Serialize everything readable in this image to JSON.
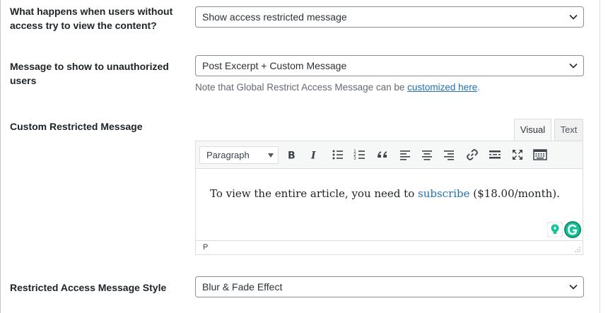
{
  "fields": {
    "access_behavior": {
      "label": "What happens when users without access try to view the content?",
      "value": "Show access restricted message"
    },
    "unauthorized_message": {
      "label": "Message to show to unauthorized users",
      "value": "Post Excerpt + Custom Message",
      "note_prefix": "Note that Global Restrict Access Message can be ",
      "note_link": "customized here",
      "note_suffix": "."
    },
    "custom_message": {
      "label": "Custom Restricted Message"
    },
    "message_style": {
      "label": "Restricted Access Message Style",
      "value": "Blur & Fade Effect"
    }
  },
  "editor": {
    "tabs": {
      "visual": "Visual",
      "text": "Text"
    },
    "active_tab": "Visual",
    "format_select": "Paragraph",
    "toolbar_icons": [
      "bold-icon",
      "italic-icon",
      "bullet-list-icon",
      "numbered-list-icon",
      "blockquote-icon",
      "align-left-icon",
      "align-center-icon",
      "align-right-icon",
      "link-icon",
      "read-more-icon",
      "fullscreen-icon",
      "toolbar-toggle-icon"
    ],
    "content": {
      "before": "To view the entire article, you need to ",
      "link": "subscribe",
      "after": " ($18.00/month)."
    },
    "status_path": "P"
  },
  "colors": {
    "link": "#2271b1",
    "grammarly_green": "#15c39a",
    "grammarly_dark": "#0e8c6a"
  }
}
